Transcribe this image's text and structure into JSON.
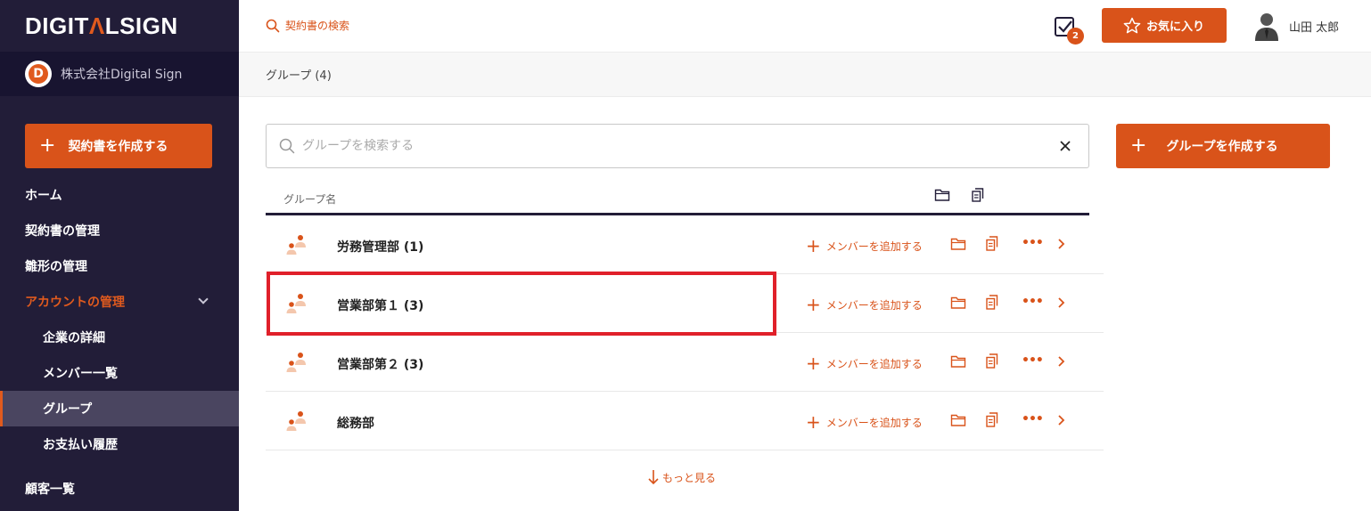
{
  "sidebar": {
    "logo_part1": "DIGIT",
    "logo_accent": "Λ",
    "logo_part2": "LSIGN",
    "company_initial": "D",
    "company_name": "株式会社Digital Sign",
    "create_contract_label": "契約書を作成する",
    "nav": {
      "home": "ホーム",
      "contracts": "契約書の管理",
      "templates": "雛形の管理",
      "account": "アカウントの管理",
      "company_details": "企業の詳細",
      "members": "メンバー一覧",
      "groups": "グループ",
      "payments": "お支払い履歴",
      "customers": "顧客一覧"
    }
  },
  "topbar": {
    "search_label": "契約書の検索",
    "task_badge_count": "2",
    "favorites_label": "お気に入り",
    "user_name": "山田 太郎"
  },
  "page": {
    "title": "グループ (4)"
  },
  "group_search": {
    "placeholder": "グループを検索する"
  },
  "create_group_label": "グループを作成する",
  "table": {
    "header_name": "グループ名",
    "rows": [
      {
        "name": "労務管理部 (1)",
        "add_member": "メンバーを追加する"
      },
      {
        "name": "営業部第１ (3)",
        "add_member": "メンバーを追加する"
      },
      {
        "name": "営業部第２ (3)",
        "add_member": "メンバーを追加する"
      },
      {
        "name": "総務部",
        "add_member": "メンバーを追加する"
      }
    ],
    "more_dots": "•••",
    "see_more": "もっと見る"
  },
  "colors": {
    "accent": "#d9531a",
    "sidebar_bg": "#221d38",
    "highlight": "#e0202a"
  }
}
